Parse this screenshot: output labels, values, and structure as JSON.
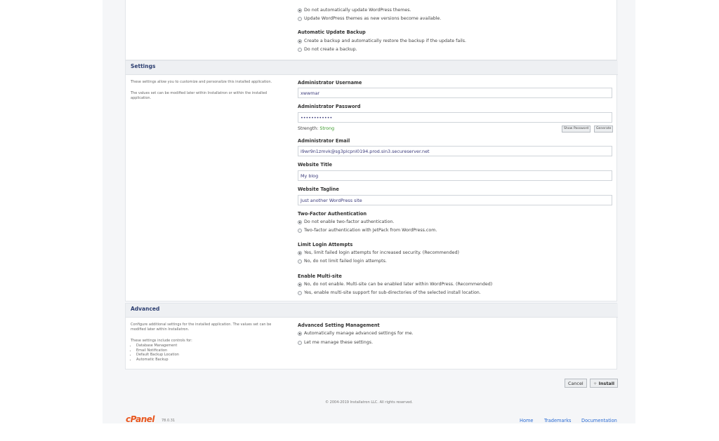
{
  "updates": {
    "themes_options": [
      "Do not automatically update WordPress themes.",
      "Update WordPress themes as new versions become available."
    ],
    "backup_label": "Automatic Update Backup",
    "backup_options": [
      "Create a backup and automatically restore the backup if the update fails.",
      "Do not create a backup."
    ]
  },
  "settings": {
    "title": "Settings",
    "desc1": "These settings allow you to customize and personalize this installed application.",
    "desc2": "The values set can be modified later within Installatron or within the installed application.",
    "admin_username_label": "Administrator Username",
    "admin_username_value": "xwwmar",
    "admin_password_label": "Administrator Password",
    "admin_password_value": "••••••••••••",
    "strength_label": "Strength:",
    "strength_value": "Strong",
    "show_password": "Show Password",
    "generate": "Generate",
    "admin_email_label": "Administrator Email",
    "admin_email_value": "i9wr9n1zmvk@sg3plcpnl0194.prod.sin3.secureserver.net",
    "website_title_label": "Website Title",
    "website_title_value": "My blog",
    "website_tagline_label": "Website Tagline",
    "website_tagline_value": "Just another WordPress site",
    "twofa_label": "Two-Factor Authentication",
    "twofa_options": [
      "Do not enable two-factor authentication.",
      "Two-factor authentication with JetPack from WordPress.com."
    ],
    "limit_label": "Limit Login Attempts",
    "limit_options": [
      "Yes, limit failed login attempts for increased security. (Recommended)",
      "No, do not limit failed login attempts."
    ],
    "multisite_label": "Enable Multi-site",
    "multisite_options": [
      "No, do not enable. Multi-site can be enabled later within WordPress. (Recommended)",
      "Yes, enable multi-site support for sub-directories of the selected install location."
    ]
  },
  "advanced": {
    "title": "Advanced",
    "desc1": "Configure additional settings for the installed application. The values set can be modified later within Installatron.",
    "desc2": "These settings include controls for:",
    "controls": [
      "Database Management",
      "Email Notification",
      "Default Backup Location",
      "Automatic Backup"
    ],
    "mgmt_label": "Advanced Setting Management",
    "mgmt_options": [
      "Automatically manage advanced settings for me.",
      "Let me manage these settings."
    ]
  },
  "actions": {
    "cancel": "Cancel",
    "install": "Install",
    "install_icon": "plus-icon"
  },
  "footer": {
    "copyright": "© 2004-2019 Installatron LLC. All rights reserved.",
    "logo": "cPanel",
    "version": "78.0.31",
    "links": [
      "Home",
      "Trademarks",
      "Documentation"
    ]
  },
  "colors": {
    "accent": "#2c3e70",
    "strong": "#3a9a2a",
    "link": "#2a6bd3",
    "brand": "#e8571f"
  }
}
